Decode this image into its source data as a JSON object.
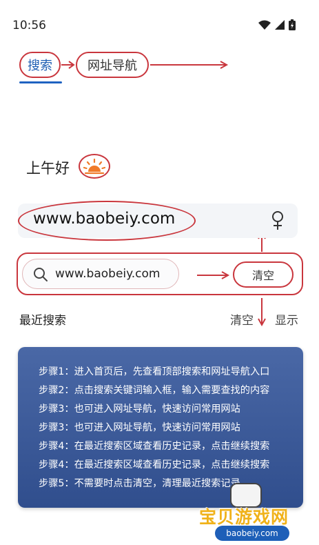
{
  "status_bar": {
    "time": "10:56"
  },
  "tabs": {
    "search_label": "搜索",
    "nav_label": "网址导航"
  },
  "greeting": {
    "text": "上午好"
  },
  "url_bar": {
    "text": "www.baobeiy.com"
  },
  "search": {
    "value": "www.baobeiy.com",
    "clear_label": "清空"
  },
  "recent": {
    "title": "最近搜索",
    "clear_label": "清空",
    "show_label": "显示"
  },
  "steps": [
    "步骤1：进入首页后，先查看顶部搜索和网址导航入口",
    "步骤2：点击搜索关键词输入框，输入需要查找的内容",
    "步骤3：也可进入网址导航，快速访问常用网站",
    "步骤3：也可进入网址导航，快速访问常用网站",
    "步骤4：在最近搜索区域查看历史记录，点击继续搜索",
    "步骤4：在最近搜索区域查看历史记录，点击继续搜索",
    "步骤5：不需要时点击清空，清理最近搜索记录"
  ],
  "watermark": {
    "title": "宝贝游戏网",
    "domain": "baobeiy.com"
  },
  "colors": {
    "annotation_red": "#c9363d",
    "accent_blue": "#1f62c1",
    "panel_blue": "#3a5896"
  }
}
